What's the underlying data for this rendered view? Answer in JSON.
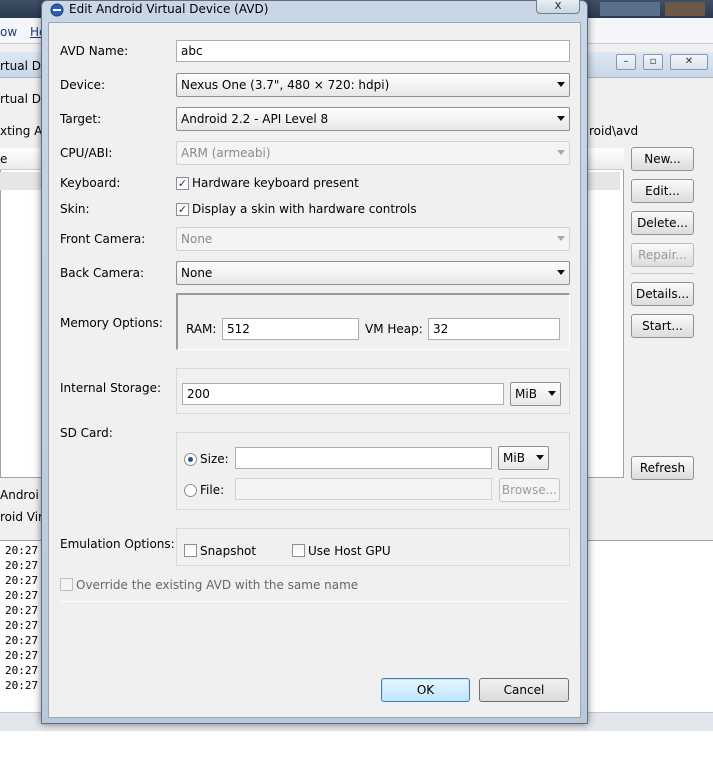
{
  "background": {
    "menu": [
      "ow",
      "He"
    ],
    "window_title": "rtual De",
    "sub_title": "rtual Dev",
    "path_left": "xting And",
    "path_right": "roid\\avd",
    "table_header": "e",
    "list_items": [
      "Androi",
      "roid Virt"
    ],
    "buttons": {
      "new": "New...",
      "edit": "Edit...",
      "delete": "Delete...",
      "repair": "Repair...",
      "details": "Details...",
      "start": "Start...",
      "refresh": "Refresh"
    },
    "window_controls": {
      "minimize": "–",
      "restore": "▫",
      "close": "✕"
    },
    "console_times": [
      "20:27",
      "20:27",
      "20:27",
      "20:27",
      "20:27",
      "20:27",
      "20:27",
      "20:27",
      "20:27",
      "20:27"
    ]
  },
  "dialog": {
    "title": "Edit Android Virtual Device (AVD)",
    "close": "x",
    "icon": "android-sdk-icon",
    "labels": {
      "avd_name": "AVD Name:",
      "device": "Device:",
      "target": "Target:",
      "cpu_abi": "CPU/ABI:",
      "keyboard": "Keyboard:",
      "skin": "Skin:",
      "front_camera": "Front Camera:",
      "back_camera": "Back Camera:",
      "memory_options": "Memory Options:",
      "internal_storage": "Internal Storage:",
      "sd_card": "SD Card:",
      "emulation_options": "Emulation Options:"
    },
    "values": {
      "avd_name": "abc",
      "device": "Nexus One (3.7\", 480 × 720: hdpi)",
      "target": "Android 2.2 - API Level 8",
      "cpu_abi": "ARM (armeabi)",
      "keyboard": "Hardware keyboard present",
      "skin": "Display a skin with hardware controls",
      "front_camera": "None",
      "back_camera": "None",
      "ram_label": "RAM:",
      "ram": "512",
      "vm_heap_label": "VM Heap:",
      "vm_heap": "32",
      "internal_storage": "200",
      "internal_storage_unit": "MiB",
      "sd_size_label": "Size:",
      "sd_size": "",
      "sd_size_unit": "MiB",
      "sd_file_label": "File:",
      "sd_file": "",
      "browse": "Browse...",
      "snapshot": "Snapshot",
      "use_host_gpu": "Use Host GPU",
      "override": "Override the existing AVD with the same name"
    },
    "checked": {
      "keyboard": "✓",
      "skin": "✓"
    },
    "buttons": {
      "ok": "OK",
      "cancel": "Cancel"
    }
  }
}
